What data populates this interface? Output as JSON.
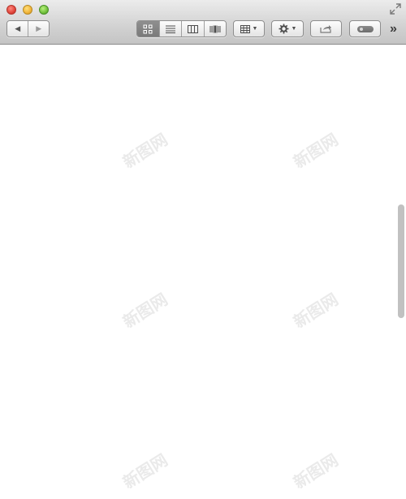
{
  "window": {
    "traffic_lights": [
      "close",
      "minimize",
      "zoom"
    ],
    "fullscreen_icon": "fullscreen-arrows-icon"
  },
  "toolbar": {
    "back_icon": "◀",
    "forward_icon": "▶",
    "view_modes": [
      "icon-view",
      "list-view",
      "column-view",
      "cover-flow-view"
    ],
    "active_view": "icon-view",
    "arrange_icon": "arrange-grid-icon",
    "action_icon": "gear-icon",
    "share_icon": "share-icon",
    "tags_icon": "tags-pill-icon",
    "overflow_label": "»"
  },
  "content": {
    "watermark_text": "新图网",
    "scroll": {
      "thumb_fraction_visible": 0.25
    }
  },
  "colors": {
    "toolbar_top": "#ececec",
    "toolbar_bottom": "#c4c4c4",
    "active_segment": "#7f7f7f",
    "close": "#e0443a",
    "minimize": "#f0b33a",
    "zoom": "#71c13c"
  }
}
